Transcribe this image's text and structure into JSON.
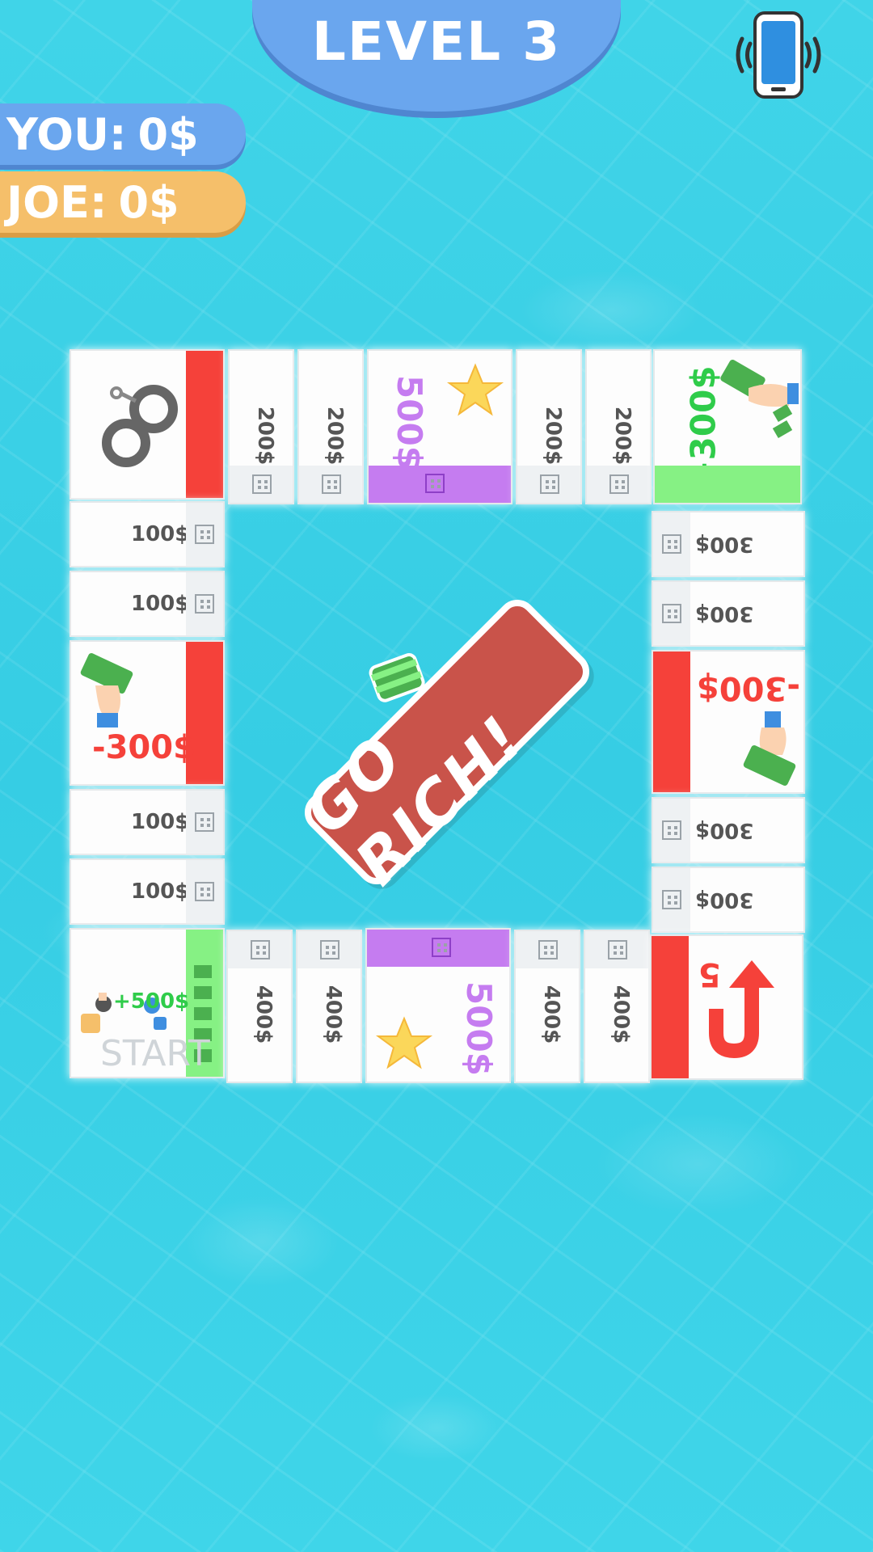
{
  "header": {
    "level_label": "LEVEL 3"
  },
  "scores": {
    "you": {
      "name": "YOU:",
      "amount": "0$"
    },
    "joe": {
      "name": "JOE:",
      "amount": "0$"
    }
  },
  "board": {
    "center_sign": "GO RICH!",
    "start_label": "START",
    "start_bonus": "+500$",
    "top_tiles": [
      "200$",
      "200$",
      "500$",
      "200$",
      "200$"
    ],
    "top_right_bonus": "+300$",
    "left_tiles": [
      "100$",
      "100$",
      "100$",
      "100$"
    ],
    "left_penalty": "-300$",
    "right_tiles": [
      "300$",
      "300$",
      "300$",
      "300$"
    ],
    "right_penalty": "-300$",
    "bottom_tiles": [
      "400$",
      "400$",
      "500$",
      "400$",
      "400$"
    ],
    "uturn_number": "5",
    "colors": {
      "red": "#f5413a",
      "green": "#86f184",
      "purple": "#c57cf0",
      "banner": "#6aa6ee",
      "joe": "#f5bf6a"
    }
  },
  "icons": [
    "handcuffs-icon",
    "money-hand-icon",
    "star-icon",
    "u-turn-arrow-icon",
    "phone-vibrate-icon",
    "dice-icon",
    "building-icon"
  ]
}
